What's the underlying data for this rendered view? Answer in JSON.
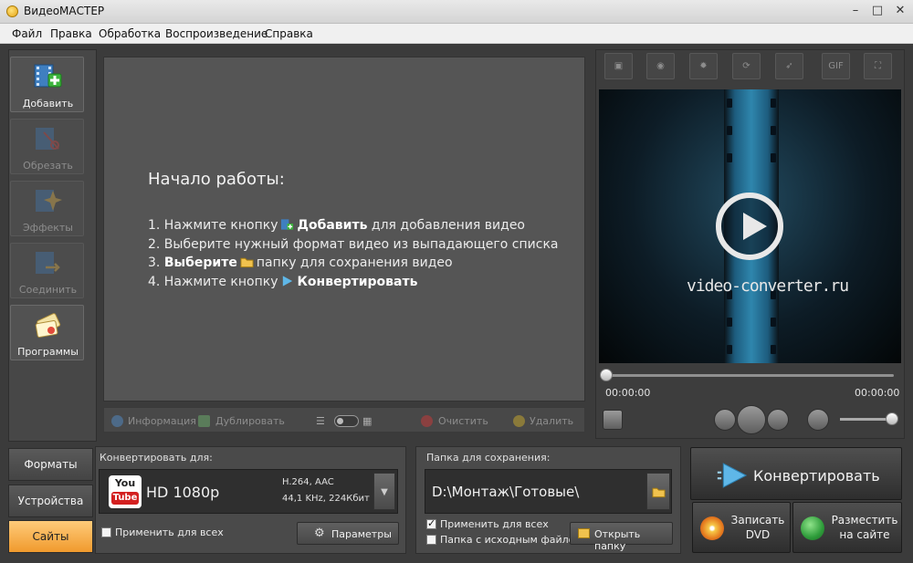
{
  "app": {
    "title": "ВидеоМАСТЕР"
  },
  "window_controls": {
    "minimize": "–",
    "maximize": "□",
    "close": "✕"
  },
  "menu": [
    "Файл",
    "Правка",
    "Обработка",
    "Воспроизведение",
    "Справка"
  ],
  "tools": [
    {
      "label": "Добавить",
      "icon": "film-add-icon",
      "enabled": true
    },
    {
      "label": "Обрезать",
      "icon": "film-scissors-icon",
      "enabled": false
    },
    {
      "label": "Эффекты",
      "icon": "sparkle-effects-icon",
      "enabled": false
    },
    {
      "label": "Соединить",
      "icon": "film-join-icon",
      "enabled": false
    },
    {
      "label": "Программы",
      "icon": "programs-icon",
      "enabled": true
    }
  ],
  "start": {
    "title": "Начало работы:",
    "step1_prefix": "1. Нажмите кнопку",
    "step1_bold": "Добавить",
    "step1_suffix": "для добавления видео",
    "step2": "2. Выберите нужный формат видео из выпадающего списка",
    "step3_prefix": "3.",
    "step3_bold": "Выберите",
    "step3_suffix": "папку для сохранения видео",
    "step4_prefix": "4. Нажмите кнопку",
    "step4_bold": "Конвертировать"
  },
  "list_toolbar": {
    "info": "Информация",
    "duplicate": "Дублировать",
    "clear": "Очистить",
    "delete": "Удалить"
  },
  "player": {
    "watermark": "video-converter.ru",
    "time_current": "00:00:00",
    "time_total": "00:00:00",
    "progress": 0,
    "volume": 1,
    "top_tools": [
      "crop-icon",
      "stabilize-icon",
      "brightness-icon",
      "rotate-icon",
      "speed-icon",
      "gif-icon",
      "fullscreen-icon"
    ],
    "gif_label": "GIF"
  },
  "tabs": [
    {
      "label": "Форматы",
      "active": false
    },
    {
      "label": "Устройства",
      "active": false
    },
    {
      "label": "Сайты",
      "active": true
    }
  ],
  "convert": {
    "title": "Конвертировать для:",
    "format_name": "HD 1080p",
    "spec_line1": "H.264, AAC",
    "spec_line2": "44,1 KHz, 224Кбит",
    "logo_you": "You",
    "logo_tube": "Tube",
    "apply_all": "Применить для всех",
    "params_button": "Параметры"
  },
  "save": {
    "title": "Папка для сохранения:",
    "path": "D:\\Монтаж\\Готовые\\",
    "apply_all": "Применить для всех",
    "apply_all_checked": true,
    "source_folder": "Папка с исходным файлом",
    "source_folder_checked": false,
    "open_folder": "Открыть папку"
  },
  "actions": {
    "convert": "Конвертировать",
    "dvd_line1": "Записать",
    "dvd_line2": "DVD",
    "publish_line1": "Разместить",
    "publish_line2": "на сайте"
  },
  "colors": {
    "accent_tab": "#f09a2d",
    "panel": "#555555",
    "background": "#3b3b3b"
  }
}
